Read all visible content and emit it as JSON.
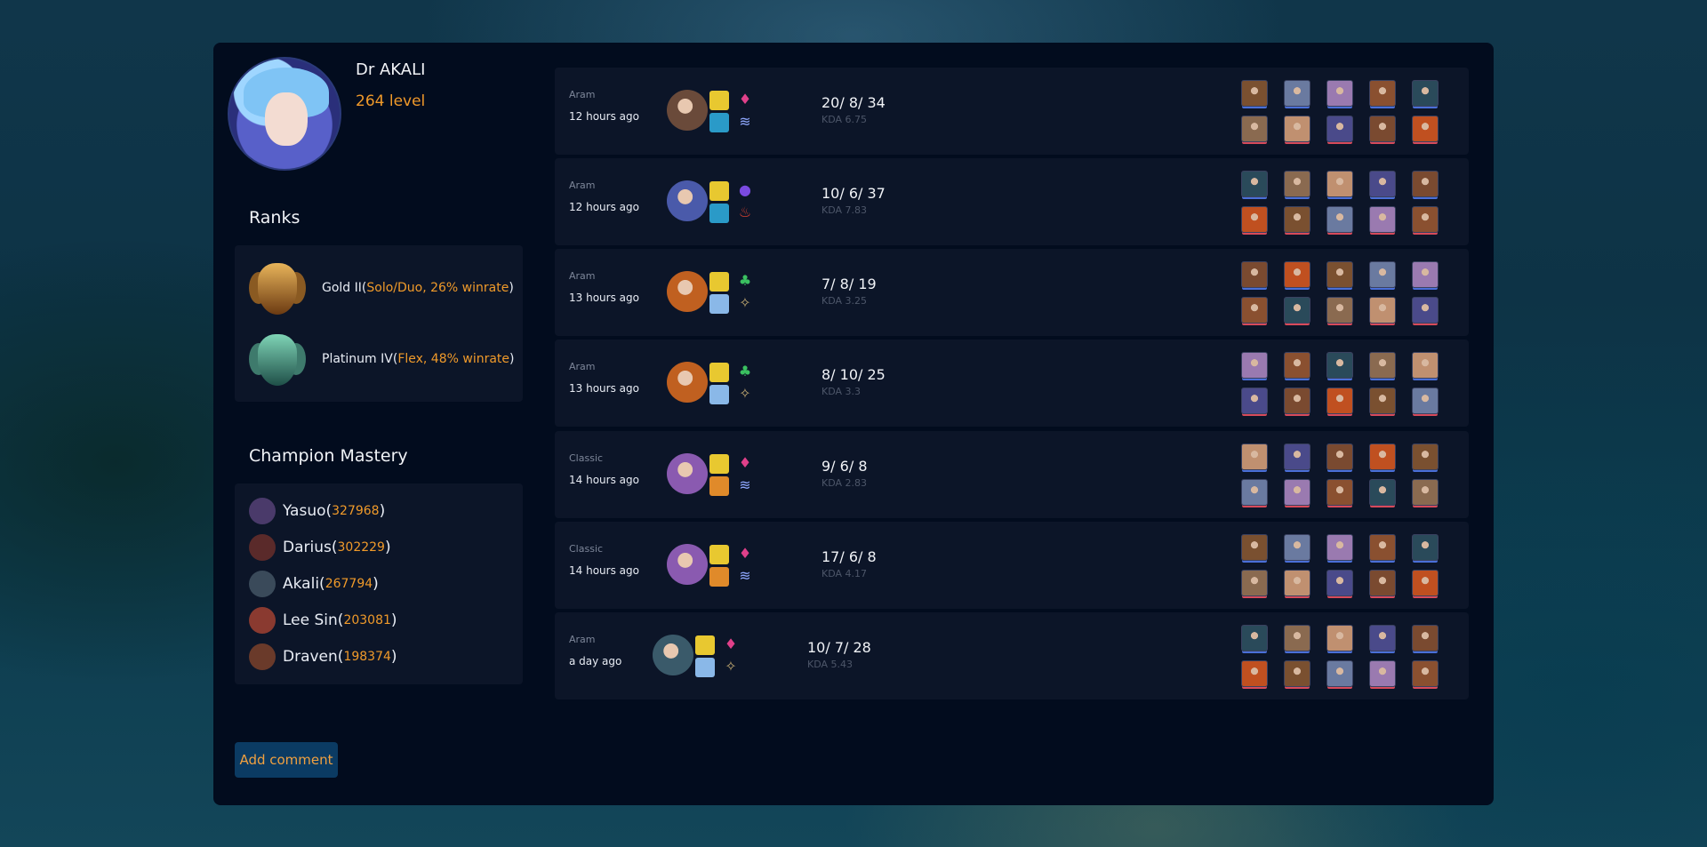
{
  "profile": {
    "name": "Dr AKALI",
    "level": "264 level"
  },
  "ranks": {
    "title": "Ranks",
    "items": [
      {
        "tier": "Gold II",
        "queue": "Solo/Duo, 26% winrate",
        "emblem": "gold-emblem-icon"
      },
      {
        "tier": "Platinum IV",
        "queue": "Flex, 48% winrate",
        "emblem": "platinum-emblem-icon"
      }
    ]
  },
  "mastery": {
    "title": "Champion Mastery",
    "items": [
      {
        "champion": "Yasuo",
        "points": "327968",
        "color": "#4a3a6a"
      },
      {
        "champion": "Darius",
        "points": "302229",
        "color": "#5a2a2a"
      },
      {
        "champion": "Akali",
        "points": "267794",
        "color": "#3a4a5a"
      },
      {
        "champion": "Lee Sin",
        "points": "203081",
        "color": "#8a3a30"
      },
      {
        "champion": "Draven",
        "points": "198374",
        "color": "#6a3a2a"
      }
    ]
  },
  "add_comment_label": "Add comment",
  "matches": [
    {
      "mode": "Aram",
      "ago": "12 hours ago",
      "score": "20/ 8/ 34",
      "kda": "KDA 6.75",
      "champ_color": "#6a4a3a",
      "spell2_color": "#2a9ac8",
      "rune1": "♦",
      "rune1_color": "#e0408a",
      "rune2": "≋",
      "rune2_color": "#8fa8ff"
    },
    {
      "mode": "Aram",
      "ago": "12 hours ago",
      "score": "10/ 6/ 37",
      "kda": "KDA 7.83",
      "champ_color": "#4a5aaa",
      "spell2_color": "#2a9ac8",
      "rune1": "●",
      "rune1_color": "#7a4ae0",
      "rune2": "♨",
      "rune2_color": "#d84030"
    },
    {
      "mode": "Aram",
      "ago": "13 hours ago",
      "score": "7/ 8/ 19",
      "kda": "KDA 3.25",
      "champ_color": "#c06020",
      "spell2_color": "#8ab8e8",
      "rune1": "♣",
      "rune1_color": "#3ac060",
      "rune2": "✧",
      "rune2_color": "#c0a870"
    },
    {
      "mode": "Aram",
      "ago": "13 hours ago",
      "score": "8/ 10/ 25",
      "kda": "KDA 3.3",
      "champ_color": "#c06020",
      "spell2_color": "#8ab8e8",
      "rune1": "♣",
      "rune1_color": "#3ac060",
      "rune2": "✧",
      "rune2_color": "#c0a870"
    },
    {
      "mode": "Classic",
      "ago": "14 hours ago",
      "score": "9/ 6/ 8",
      "kda": "KDA 2.83",
      "champ_color": "#8a5ab0",
      "spell2_color": "#e08a2a",
      "rune1": "♦",
      "rune1_color": "#e0408a",
      "rune2": "≋",
      "rune2_color": "#8fa8ff"
    },
    {
      "mode": "Classic",
      "ago": "14 hours ago",
      "score": "17/ 6/ 8",
      "kda": "KDA 4.17",
      "champ_color": "#8a5ab0",
      "spell2_color": "#e08a2a",
      "rune1": "♦",
      "rune1_color": "#e0408a",
      "rune2": "≋",
      "rune2_color": "#8fa8ff"
    },
    {
      "mode": "Aram",
      "ago": "a day ago",
      "score": "10/ 7/ 28",
      "kda": "KDA 5.43",
      "champ_color": "#3a5a6a",
      "spell2_color": "#8ab8e8",
      "rune1": "♦",
      "rune1_color": "#e0408a",
      "rune2": "✧",
      "rune2_color": "#c0a870"
    }
  ],
  "colors": {
    "accent": "#f09a2a",
    "panel": "#020c1e",
    "card": "#0c1528",
    "button": "#0b3b63"
  }
}
